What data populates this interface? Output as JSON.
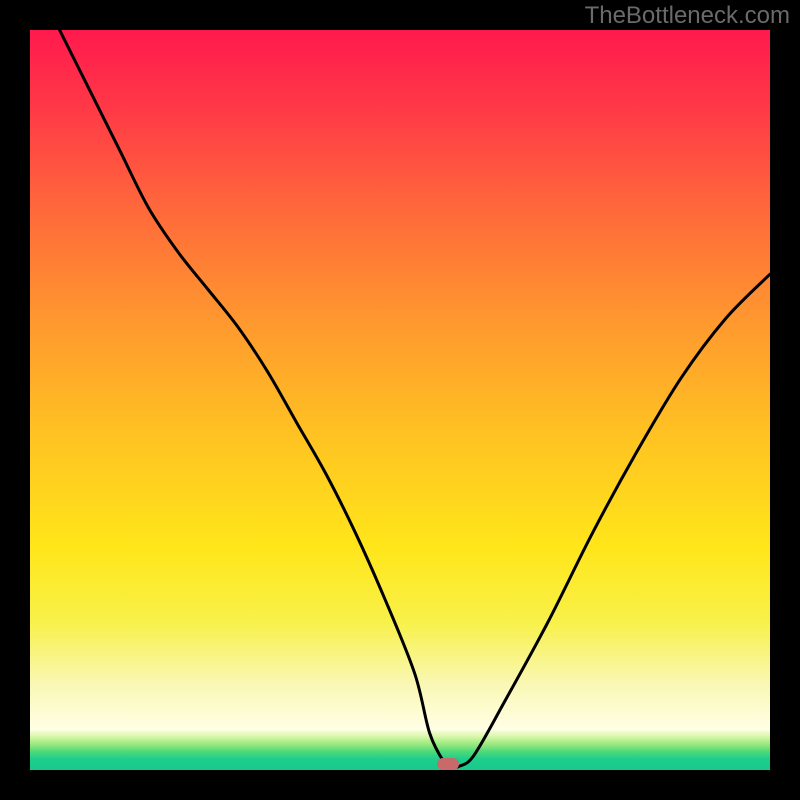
{
  "watermark": "TheBottleneck.com",
  "gradient": {
    "stops": [
      {
        "offset": 0.0,
        "color": "#ff1a4d"
      },
      {
        "offset": 0.1,
        "color": "#ff3747"
      },
      {
        "offset": 0.25,
        "color": "#ff6b3a"
      },
      {
        "offset": 0.4,
        "color": "#ff9a2e"
      },
      {
        "offset": 0.55,
        "color": "#ffc322"
      },
      {
        "offset": 0.7,
        "color": "#ffe61a"
      },
      {
        "offset": 0.8,
        "color": "#f8f14a"
      },
      {
        "offset": 0.88,
        "color": "#f9f7b0"
      },
      {
        "offset": 0.945,
        "color": "#ffffe6"
      },
      {
        "offset": 0.955,
        "color": "#d6f7a8"
      },
      {
        "offset": 0.965,
        "color": "#9ae97f"
      },
      {
        "offset": 0.975,
        "color": "#4fd97a"
      },
      {
        "offset": 0.985,
        "color": "#1ece8c"
      },
      {
        "offset": 1.0,
        "color": "#19c98c"
      }
    ]
  },
  "marker": {
    "x_frac": 0.565,
    "y_frac": 0.992
  },
  "chart_data": {
    "type": "line",
    "title": "",
    "xlabel": "",
    "ylabel": "",
    "xlim": [
      0,
      100
    ],
    "ylim": [
      0,
      100
    ],
    "series": [
      {
        "name": "bottleneck-curve",
        "x": [
          4,
          8,
          12,
          16,
          20,
          24,
          28,
          32,
          36,
          40,
          44,
          48,
          52,
          54,
          56,
          57,
          58,
          60,
          64,
          70,
          76,
          82,
          88,
          94,
          100
        ],
        "y": [
          100,
          92,
          84,
          76,
          70,
          65,
          60,
          54,
          47,
          40,
          32,
          23,
          13,
          5,
          1,
          0.5,
          0.5,
          2,
          9,
          20,
          32,
          43,
          53,
          61,
          67
        ]
      }
    ],
    "annotations": [
      {
        "type": "marker",
        "x": 56.5,
        "y": 0.8,
        "label": "optimal-point"
      }
    ]
  }
}
